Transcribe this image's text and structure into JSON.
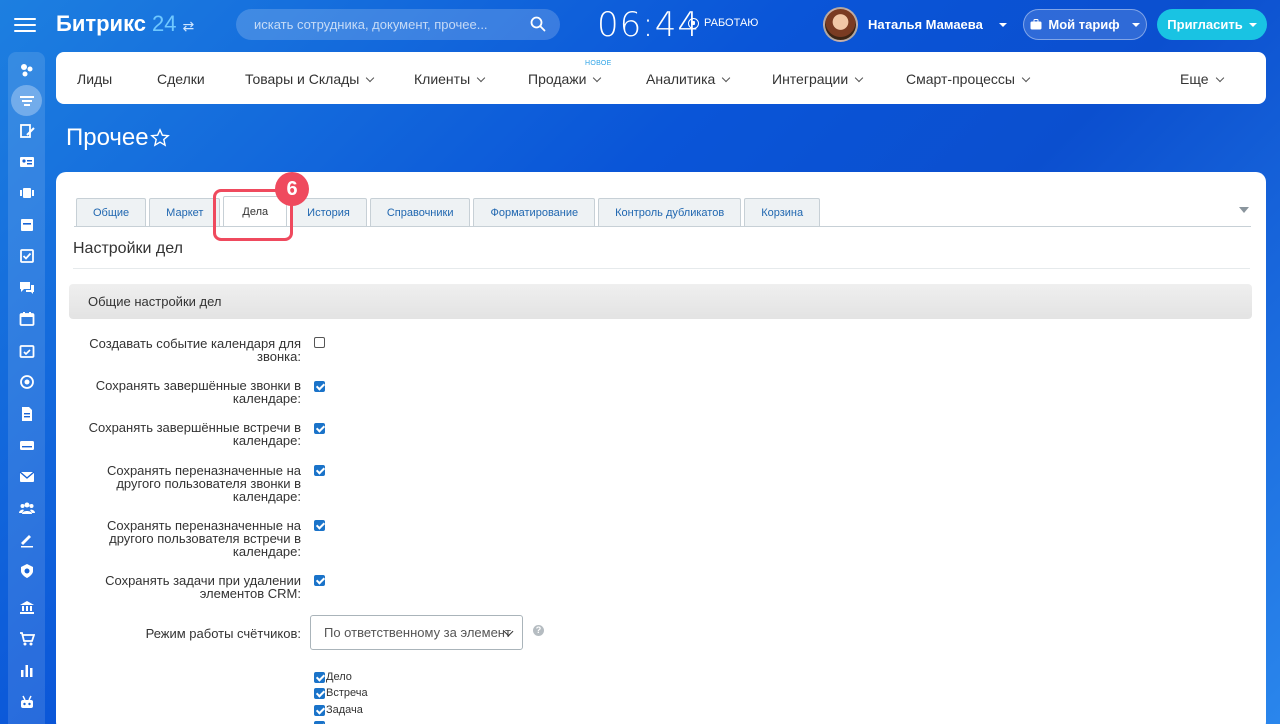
{
  "header": {
    "logo_text": "Битрикс",
    "logo_num": "24",
    "search_placeholder": "искать сотрудника, документ, прочее...",
    "clock": "06:44",
    "work_status": "РАБОТАЮ",
    "user_name": "Наталья Мамаева",
    "tariff_label": "Мой тариф",
    "invite_label": "Пригласить"
  },
  "crm_menu": {
    "items": [
      "Лиды",
      "Сделки",
      "Товары и Склады",
      "Клиенты",
      "Продажи",
      "Аналитика",
      "Интеграции",
      "Смарт-процессы",
      "Еще"
    ],
    "new_badge": "НОВОЕ"
  },
  "page": {
    "title": "Прочее"
  },
  "tabs": [
    "Общие",
    "Маркет",
    "Дела",
    "История",
    "Справочники",
    "Форматирование",
    "Контроль дубликатов",
    "Корзина"
  ],
  "active_tab": "Дела",
  "step_badge": "6",
  "settings": {
    "section_title": "Настройки дел",
    "group_title": "Общие настройки дел",
    "rows": [
      {
        "label": "Создавать событие календаря для звонка:",
        "checked": false
      },
      {
        "label": "Сохранять завершённые звонки в календаре:",
        "checked": true
      },
      {
        "label": "Сохранять завершённые встречи в календаре:",
        "checked": true
      },
      {
        "label": "Сохранять переназначенные на другого пользователя звонки в календаре:",
        "checked": true
      },
      {
        "label": "Сохранять переназначенные на другого пользователя встречи в календаре:",
        "checked": true
      },
      {
        "label": "Сохранять задачи при удалении элементов CRM:",
        "checked": true
      }
    ],
    "counter_mode_label": "Режим работы счётчиков:",
    "counter_mode_value": "По ответственному за элемент",
    "help_glyph": "?",
    "counter_options": [
      {
        "label": "Дело",
        "checked": true
      },
      {
        "label": "Встреча",
        "checked": true
      },
      {
        "label": "Задача",
        "checked": true
      }
    ]
  },
  "colors": {
    "accent": "#1a73c9",
    "highlight": "#ef4a5e",
    "invite": "#19c3e3"
  }
}
